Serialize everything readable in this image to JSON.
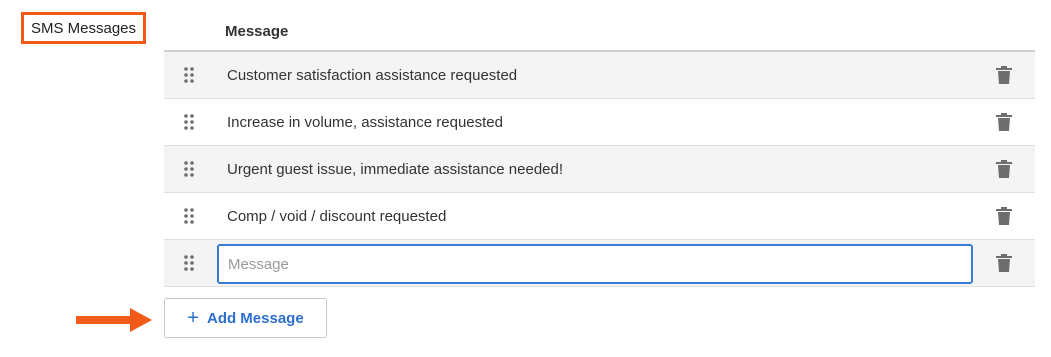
{
  "callout_label": "SMS Messages",
  "table": {
    "header": "Message",
    "rows": [
      {
        "text": "Customer satisfaction assistance requested"
      },
      {
        "text": "Increase in volume, assistance requested"
      },
      {
        "text": "Urgent guest issue, immediate assistance needed!"
      },
      {
        "text": "Comp / void / discount requested"
      }
    ],
    "new_row": {
      "value": "",
      "placeholder": "Message"
    }
  },
  "add_button": {
    "label": "Add Message",
    "icon": "plus-icon"
  },
  "icons": {
    "drag": "drag-handle-icon",
    "delete": "trash-icon",
    "callout": "arrow-right-icon"
  },
  "colors": {
    "accent": "#2b6fcf",
    "callout": "#f25a19",
    "input_focus": "#3a7bd5",
    "icon": "#6e6e6e"
  }
}
